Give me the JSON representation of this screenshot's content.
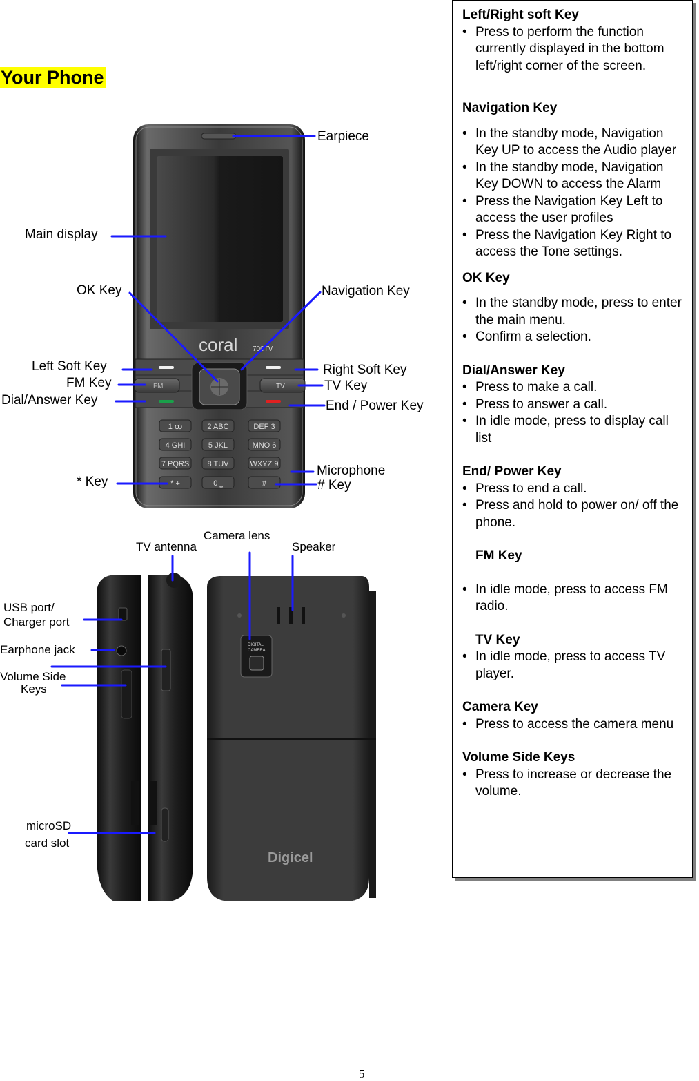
{
  "page": {
    "heading": "Your Phone",
    "page_number": "5"
  },
  "diagram": {
    "front_labels": {
      "earpiece": "Earpiece",
      "main_display": "Main display",
      "ok_key": "OK Key",
      "navigation_key": "Navigation Key",
      "left_soft_key": "Left Soft Key",
      "fm_key": "FM Key",
      "dial_answer_key": "Dial/Answer  Key",
      "right_soft_key": "Right Soft Key",
      "tv_key": "TV Key",
      "end_power_key": "End / Power Key",
      "microphone": "Microphone",
      "hash_key": "# Key",
      "star_key": "* Key"
    },
    "side_back_labels": {
      "tv_antenna": "TV antenna",
      "camera_lens": "Camera lens",
      "speaker": "Speaker",
      "usb_port_line1": "USB port/",
      "usb_port_line2": "Charger port",
      "earphone_jack": "Earphone jack",
      "volume_line1": "Volume Side",
      "volume_line2": "Keys",
      "microsd_line1": "microSD",
      "microsd_line2": "card slot"
    },
    "phone_markings": {
      "brand": "coral",
      "model": "700TV",
      "fm_button": "FM",
      "tv_button": "TV",
      "back_brand": "Digicel",
      "camera_text_1": "DIGITAL",
      "camera_text_2": "CAMERA",
      "keypad": [
        [
          "1 ꝏ",
          "2 ABC",
          "DEF 3"
        ],
        [
          "4 GHI",
          "5 JKL",
          "MNO 6"
        ],
        [
          "7 PQRS",
          "8 TUV",
          "WXYZ 9"
        ],
        [
          "* +",
          "0 ⎵",
          "# "
        ]
      ]
    }
  },
  "info_box": {
    "sections": [
      {
        "title": "Left/Right soft Key",
        "items": [
          "Press to perform the function currently displayed in the bottom left/right corner of the screen."
        ]
      },
      {
        "title": "Navigation Key",
        "items": [
          "In the standby mode,  Navigation Key UP to access the Audio player",
          "In the standby mode,  Navigation Key DOWN to access the Alarm",
          "Press the Navigation Key Left to access the user profiles",
          "Press the Navigation Key Right to access the Tone settings."
        ]
      },
      {
        "title": "OK Key",
        "items": [
          "In the standby mode, press to enter the main menu.",
          "Confirm a selection."
        ]
      },
      {
        "title": "Dial/Answer Key",
        "items": [
          "Press to make a call.",
          "Press to answer a call.",
          "In idle mode, press to display call list"
        ]
      },
      {
        "title": "End/ Power Key",
        "items": [
          "Press to end a call.",
          "Press and hold to power on/ off the phone."
        ]
      },
      {
        "title": "FM Key",
        "items": [
          "In idle mode, press to access FM radio."
        ]
      },
      {
        "title": "TV Key",
        "items": [
          "In idle mode, press to access TV player."
        ]
      },
      {
        "title": "Camera Key",
        "items": [
          "Press to access the camera menu"
        ]
      },
      {
        "title": "Volume Side Keys",
        "items": [
          "Press to increase or decrease the volume."
        ]
      }
    ]
  },
  "colors": {
    "highlight": "#ffff00",
    "callout_line": "#1a1aff",
    "phone_body": "#2a2a2a"
  }
}
